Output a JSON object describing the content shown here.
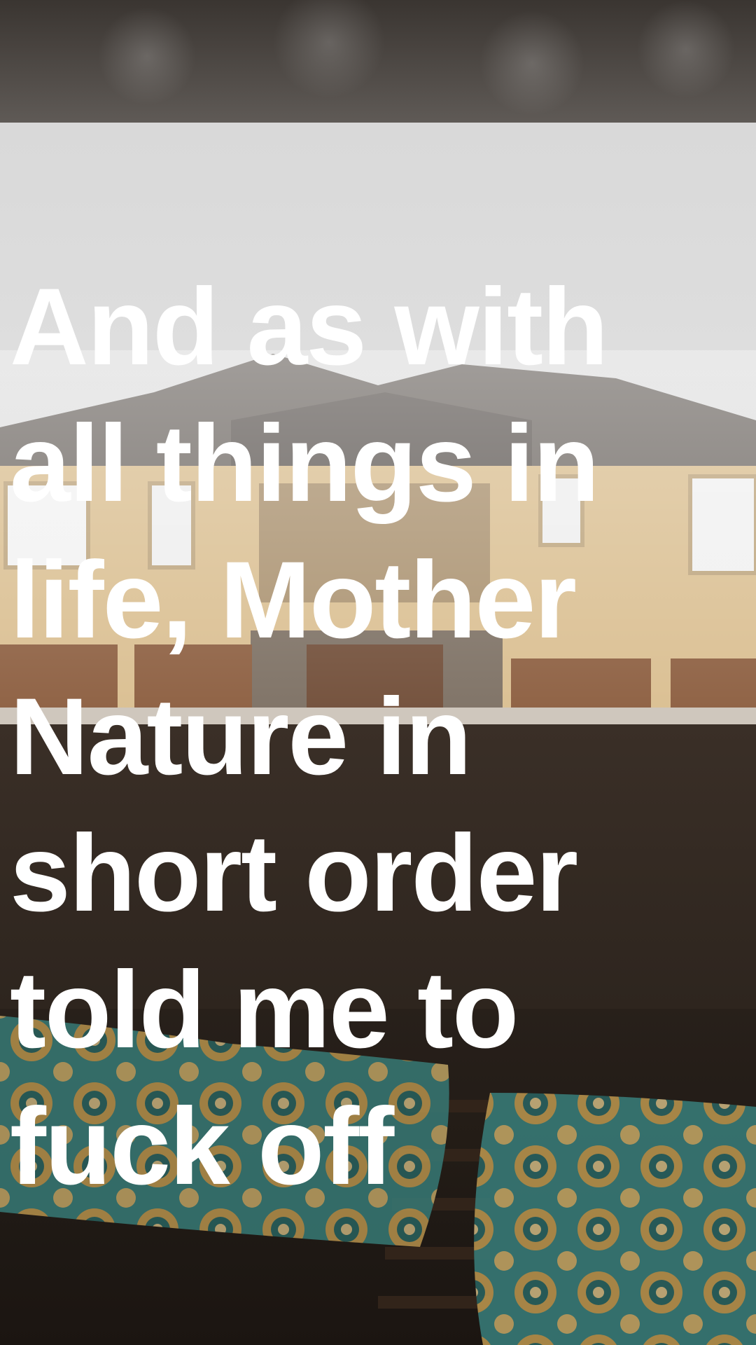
{
  "photo": {
    "subject": "view through a rainy window of a two-story apartment building, with patterned cushions on a bench in the foreground",
    "colors": {
      "sky": "#dcdcdc",
      "roof": "#6f6964",
      "wall": "#d9bd8e",
      "stone": "#7a6d60",
      "garage": "#8a5b3c",
      "railing": "#2a211b",
      "cushion_teal": "#3f8a86",
      "cushion_gold": "#cfa556"
    }
  },
  "caption": {
    "lines": [
      "And as with",
      "all things in",
      "life, Mother",
      "Nature in",
      "short order",
      "told me to",
      "fuck off"
    ],
    "color": "#ffffff"
  }
}
